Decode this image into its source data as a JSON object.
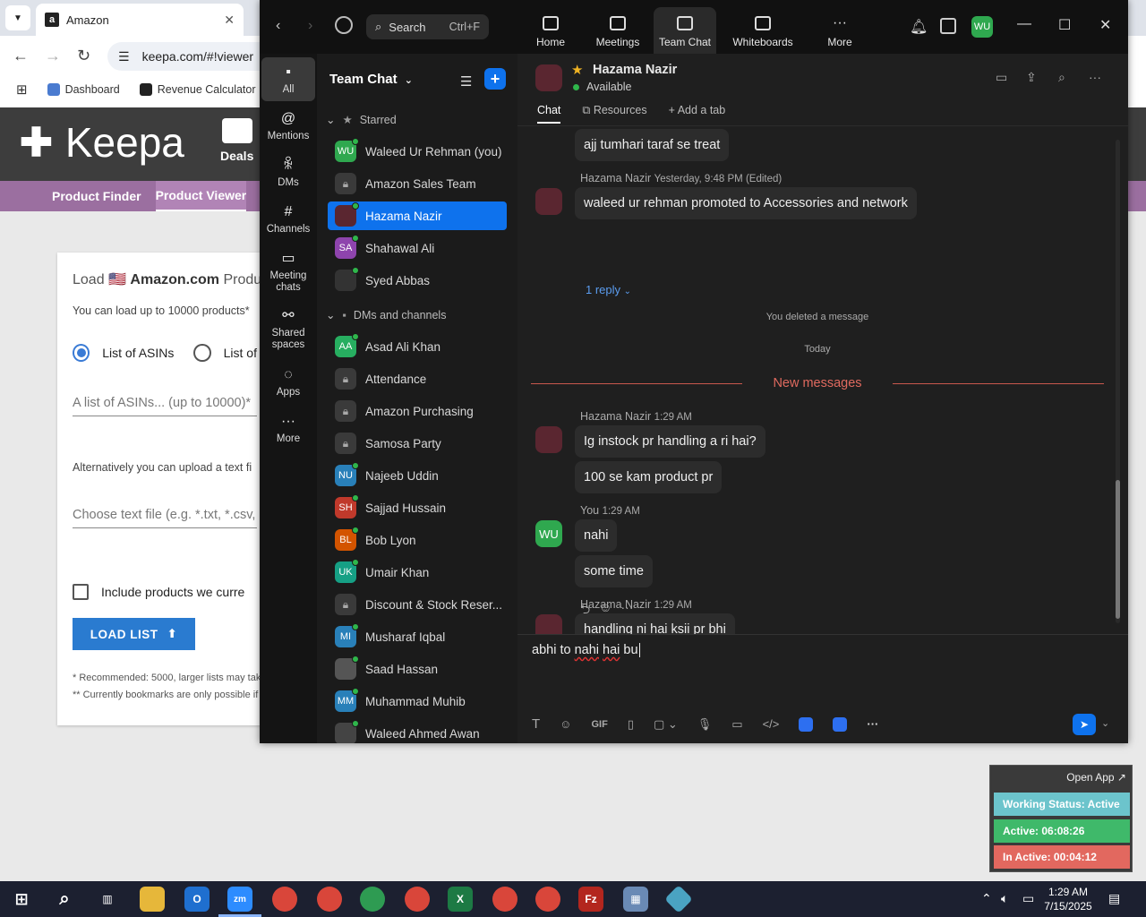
{
  "browser": {
    "tab_title": "Amazon",
    "tab_favicon": "a",
    "url": "keepa.com/#!viewer",
    "bookmarks": [
      {
        "label": "Dashboard",
        "icon": "amazon-bookmark-icon"
      },
      {
        "label": "Revenue Calculator",
        "icon": "amazon-bookmark-icon"
      }
    ]
  },
  "keepa": {
    "logo": "Keepa",
    "deals": "Deals",
    "subnav": [
      "Product Finder",
      "Product Viewer"
    ],
    "card": {
      "title_prefix": "Load",
      "title_flag": "🇺🇸",
      "title_bold": "Amazon.com",
      "title_suffix": "Produc",
      "sub": "You can load up to 10000 products*",
      "radio_1": "List of ASINs",
      "radio_2": "List of",
      "input_placeholder": "A list of ASINs... (up to 10000)*",
      "alt_text": "Alternatively you can upload a text fi",
      "file_placeholder": "Choose text file (e.g. *.txt, *.csv,",
      "checkbox_label": "Include products we curre",
      "load_button": "LOAD LIST",
      "note_1": "* Recommended: 5000, larger lists may take",
      "note_2": "** Currently bookmarks are only possible if"
    }
  },
  "zoom": {
    "search_label": "Search",
    "search_shortcut": "Ctrl+F",
    "top_tabs": [
      "Home",
      "Meetings",
      "Team Chat",
      "Whiteboards",
      "More"
    ],
    "avatar_initials": "WU",
    "rail": [
      "All",
      "Mentions",
      "DMs",
      "Channels",
      "Meeting chats",
      "Shared spaces",
      "Apps",
      "More"
    ],
    "list": {
      "title": "Team Chat",
      "starred_label": "Starred",
      "dms_label": "DMs and channels",
      "starred": [
        {
          "name": "Waleed Ur Rehman (you)",
          "initials": "WU",
          "color": "#2fa84f",
          "kind": "avatar"
        },
        {
          "name": "Amazon Sales Team",
          "kind": "lock"
        },
        {
          "name": "Hazama Nazir",
          "color": "#5a2630",
          "kind": "avatar",
          "selected": true
        },
        {
          "name": "Shahawal Ali",
          "initials": "SA",
          "color": "#8e44ad",
          "kind": "avatar"
        },
        {
          "name": "Syed Abbas",
          "color": "#333333",
          "kind": "avatar"
        }
      ],
      "dms": [
        {
          "name": "Asad Ali Khan",
          "initials": "AA",
          "color": "#27ae60",
          "kind": "avatar"
        },
        {
          "name": "Attendance",
          "kind": "lock"
        },
        {
          "name": "Amazon Purchasing",
          "kind": "lock"
        },
        {
          "name": "Samosa Party",
          "kind": "lock"
        },
        {
          "name": "Najeeb Uddin",
          "initials": "NU",
          "color": "#2980b9",
          "kind": "avatar"
        },
        {
          "name": "Sajjad Hussain",
          "initials": "SH",
          "color": "#c0392b",
          "kind": "avatar"
        },
        {
          "name": "Bob Lyon",
          "initials": "BL",
          "color": "#d35400",
          "kind": "avatar"
        },
        {
          "name": "Umair Khan",
          "initials": "UK",
          "color": "#16a085",
          "kind": "avatar"
        },
        {
          "name": "Discount & Stock Reser...",
          "kind": "lock"
        },
        {
          "name": "Musharaf Iqbal",
          "initials": "MI",
          "color": "#2980b9",
          "kind": "avatar"
        },
        {
          "name": "Saad Hassan",
          "color": "#555555",
          "kind": "avatar"
        },
        {
          "name": "Muhammad Muhib",
          "initials": "MM",
          "color": "#2980b9",
          "kind": "avatar"
        },
        {
          "name": "Waleed Ahmed Awan",
          "color": "#444444",
          "kind": "avatar"
        }
      ]
    },
    "chat": {
      "contact_name": "Hazama Nazir",
      "contact_status": "Available",
      "tabs": [
        "Chat",
        "Resources",
        "Add a tab"
      ],
      "messages": {
        "m1": "ajj tumhari taraf se treat",
        "meta2_name": "Hazama Nazir",
        "meta2_time": "Yesterday, 9:48 PM (Edited)",
        "m2": "waleed ur rehman promoted to Accessories and network",
        "reply": "1 reply",
        "deleted": "You deleted a message",
        "today": "Today",
        "new_messages": "New messages",
        "meta3_name": "Hazama Nazir",
        "meta3_time": "1:29 AM",
        "m3": "Ig instock pr handling a ri hai?",
        "m4": "100 se kam product pr",
        "meta4_name": "You",
        "meta4_time": "1:29 AM",
        "me_initials": "WU",
        "m5": "nahi",
        "m6": "some time",
        "meta5_name": "Hazama Nazir",
        "meta5_time": "1:29 AM",
        "m7": "handling ni hai ksii pr bhi"
      },
      "compose": {
        "w1": "abhi to ",
        "w2": "nahi",
        "w3": " ",
        "w4": "hai",
        "w5": " bu"
      },
      "tool_gif": "GIF"
    }
  },
  "status_widget": {
    "open_app": "Open App ↗",
    "working": "Working Status: Active",
    "active": "Active: 06:08:26",
    "inactive": "In Active: 00:04:12",
    "colors": {
      "working": "#6cc4cc",
      "active": "#3fb96a",
      "inactive": "#e2685f"
    }
  },
  "taskbar": {
    "time": "1:29 AM",
    "date": "7/15/2025"
  }
}
